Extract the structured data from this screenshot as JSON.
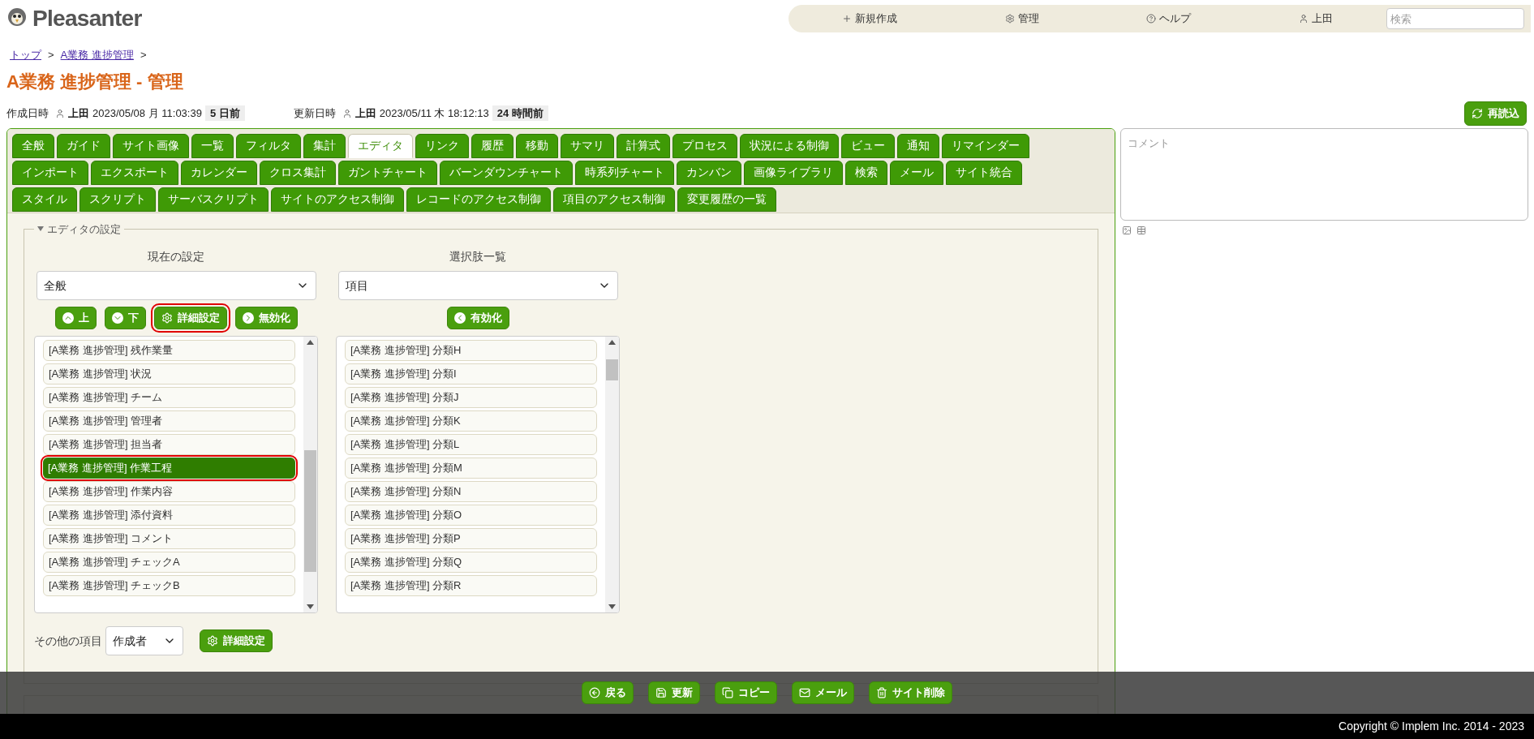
{
  "header": {
    "logo": "Pleasanter",
    "nav": [
      {
        "kind": "plus",
        "label": "新規作成"
      },
      {
        "kind": "gear",
        "label": "管理"
      },
      {
        "kind": "help",
        "label": "ヘルプ"
      },
      {
        "kind": "user",
        "label": "上田"
      }
    ],
    "search": {
      "placeholder": "検索"
    }
  },
  "breadcrumb": [
    "トップ",
    "A業務 進捗管理"
  ],
  "breadcrumb_separator": ">",
  "title": "A業務 進捗管理 - 管理",
  "meta": [
    {
      "label": "作成日時",
      "user": "上田",
      "date": "2023/05/08 月 11:03:39",
      "ago": "5 日前"
    },
    {
      "label": "更新日時",
      "user": "上田",
      "date": "2023/05/11 木 18:12:13",
      "ago": "24 時間前"
    }
  ],
  "reload_button": "再読込",
  "tab_rows": [
    [
      {
        "label": "全般",
        "selected": false
      },
      {
        "label": "ガイド",
        "selected": false
      },
      {
        "label": "サイト画像",
        "selected": false
      },
      {
        "label": "一覧",
        "selected": false
      },
      {
        "label": "フィルタ",
        "selected": false
      },
      {
        "label": "集計",
        "selected": false
      },
      {
        "label": "エディタ",
        "selected": true
      },
      {
        "label": "リンク",
        "selected": false
      },
      {
        "label": "履歴",
        "selected": false
      },
      {
        "label": "移動",
        "selected": false
      },
      {
        "label": "サマリ",
        "selected": false
      },
      {
        "label": "計算式",
        "selected": false
      },
      {
        "label": "プロセス",
        "selected": false
      },
      {
        "label": "状況による制御",
        "selected": false
      },
      {
        "label": "ビュー",
        "selected": false
      },
      {
        "label": "通知",
        "selected": false
      },
      {
        "label": "リマインダー",
        "selected": false
      }
    ],
    [
      {
        "label": "インポート",
        "selected": false
      },
      {
        "label": "エクスポート",
        "selected": false
      },
      {
        "label": "カレンダー",
        "selected": false
      },
      {
        "label": "クロス集計",
        "selected": false
      },
      {
        "label": "ガントチャート",
        "selected": false
      },
      {
        "label": "バーンダウンチャート",
        "selected": false
      },
      {
        "label": "時系列チャート",
        "selected": false
      },
      {
        "label": "カンバン",
        "selected": false
      },
      {
        "label": "画像ライブラリ",
        "selected": false
      },
      {
        "label": "検索",
        "selected": false
      },
      {
        "label": "メール",
        "selected": false
      },
      {
        "label": "サイト統合",
        "selected": false
      }
    ],
    [
      {
        "label": "スタイル",
        "selected": false
      },
      {
        "label": "スクリプト",
        "selected": false
      },
      {
        "label": "サーバスクリプト",
        "selected": false
      },
      {
        "label": "サイトのアクセス制御",
        "selected": false
      },
      {
        "label": "レコードのアクセス制御",
        "selected": false
      },
      {
        "label": "項目のアクセス制御",
        "selected": false
      },
      {
        "label": "変更履歴の一覧",
        "selected": false
      }
    ]
  ],
  "editor_settings": {
    "legend": "エディタの設定",
    "current": {
      "heading": "現在の設定",
      "select": "全般",
      "buttons": [
        {
          "kind": "up",
          "label": "上",
          "highlighted": false
        },
        {
          "kind": "down",
          "label": "下",
          "highlighted": false
        },
        {
          "kind": "gear",
          "label": "詳細設定",
          "highlighted": true
        },
        {
          "kind": "right",
          "label": "無効化",
          "highlighted": false
        }
      ],
      "items": [
        {
          "label": "[A業務 進捗管理] 残作業量",
          "selected": false
        },
        {
          "label": "[A業務 進捗管理] 状況",
          "selected": false
        },
        {
          "label": "[A業務 進捗管理] チーム",
          "selected": false
        },
        {
          "label": "[A業務 進捗管理] 管理者",
          "selected": false
        },
        {
          "label": "[A業務 進捗管理] 担当者",
          "selected": false
        },
        {
          "label": "[A業務 進捗管理] 作業工程",
          "selected": true
        },
        {
          "label": "[A業務 進捗管理] 作業内容",
          "selected": false
        },
        {
          "label": "[A業務 進捗管理] 添付資料",
          "selected": false
        },
        {
          "label": "[A業務 進捗管理] コメント",
          "selected": false
        },
        {
          "label": "[A業務 進捗管理] チェックA",
          "selected": false
        },
        {
          "label": "[A業務 進捗管理] チェックB",
          "selected": false
        }
      ]
    },
    "options": {
      "heading": "選択肢一覧",
      "select": "項目",
      "buttons": [
        {
          "kind": "left",
          "label": "有効化",
          "highlighted": false
        }
      ],
      "items": [
        {
          "label": "[A業務 進捗管理] 分類H",
          "selected": false
        },
        {
          "label": "[A業務 進捗管理] 分類I",
          "selected": false
        },
        {
          "label": "[A業務 進捗管理] 分類J",
          "selected": false
        },
        {
          "label": "[A業務 進捗管理] 分類K",
          "selected": false
        },
        {
          "label": "[A業務 進捗管理] 分類L",
          "selected": false
        },
        {
          "label": "[A業務 進捗管理] 分類M",
          "selected": false
        },
        {
          "label": "[A業務 進捗管理] 分類N",
          "selected": false
        },
        {
          "label": "[A業務 進捗管理] 分類O",
          "selected": false
        },
        {
          "label": "[A業務 進捗管理] 分類P",
          "selected": false
        },
        {
          "label": "[A業務 進捗管理] 分類Q",
          "selected": false
        },
        {
          "label": "[A業務 進捗管理] 分類R",
          "selected": false
        }
      ]
    },
    "other": {
      "label": "その他の項目",
      "select": "作成者",
      "button": "詳細設定"
    }
  },
  "comment": {
    "placeholder": "コメント"
  },
  "actions": [
    {
      "kind": "back",
      "label": "戻る"
    },
    {
      "kind": "save",
      "label": "更新"
    },
    {
      "kind": "copy",
      "label": "コピー"
    },
    {
      "kind": "mail",
      "label": "メール"
    },
    {
      "kind": "trash",
      "label": "サイト削除"
    }
  ],
  "footer": "Copyright © Implem Inc. 2014 - 2023"
}
